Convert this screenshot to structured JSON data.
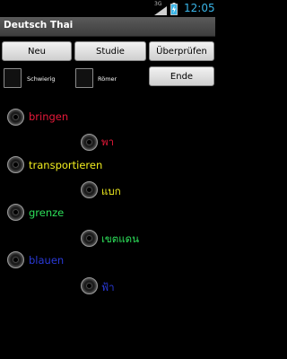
{
  "status_bar": {
    "network": "3G",
    "time": "12:05",
    "time_color": "#39b5e8"
  },
  "title_bar": {
    "title": "Deutsch Thai"
  },
  "buttons": {
    "new_label": "Neu",
    "study_label": "Studie",
    "check_label": "Überprüfen",
    "end_label": "Ende"
  },
  "options": {
    "difficult_label": "Schwierig",
    "roman_label": "Römer"
  },
  "quiz": {
    "items": [
      {
        "text": "bringen",
        "color": "#e8193a"
      },
      {
        "text": "พา",
        "color": "#e8193a"
      },
      {
        "text": "transportieren",
        "color": "#f2ee1f"
      },
      {
        "text": "แบก",
        "color": "#f2ee1f"
      },
      {
        "text": "grenze",
        "color": "#2de05a"
      },
      {
        "text": "เขตแดน",
        "color": "#2de05a"
      },
      {
        "text": "blauen",
        "color": "#2a3ad8"
      },
      {
        "text": "ฟ้า",
        "color": "#2a3ad8"
      }
    ]
  }
}
